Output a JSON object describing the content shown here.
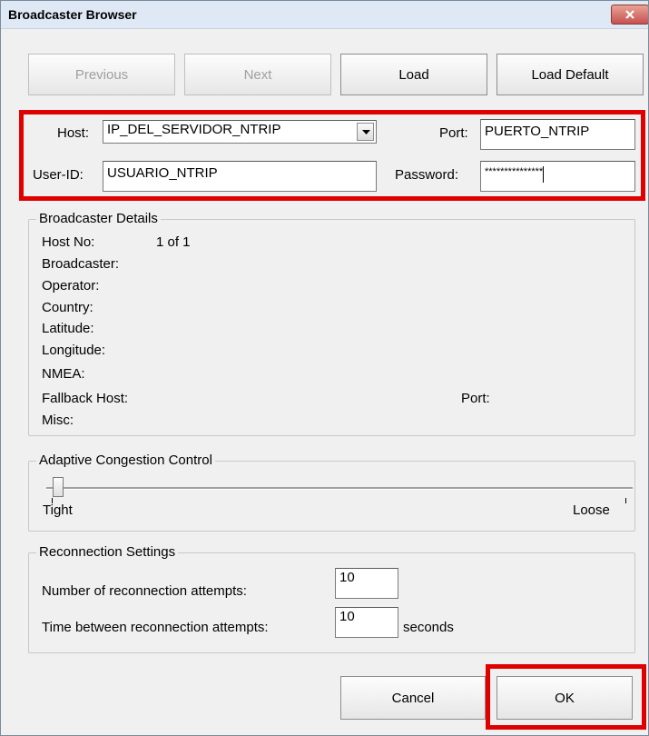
{
  "window": {
    "title": "Broadcaster Browser"
  },
  "buttons": {
    "previous": "Previous",
    "next": "Next",
    "load": "Load",
    "load_default": "Load Default",
    "cancel": "Cancel",
    "ok": "OK"
  },
  "connection": {
    "host_label": "Host:",
    "host_value": "IP_DEL_SERVIDOR_NTRIP",
    "port_label": "Port:",
    "port_value": "PUERTO_NTRIP",
    "userid_label": "User-ID:",
    "userid_value": "USUARIO_NTRIP",
    "password_label": "Password:",
    "password_value": "***************"
  },
  "details": {
    "group_label": "Broadcaster Details",
    "host_no_label": "Host No:",
    "host_no_value": "1 of 1",
    "broadcaster_label": "Broadcaster:",
    "operator_label": "Operator:",
    "country_label": "Country:",
    "latitude_label": "Latitude:",
    "longitude_label": "Longitude:",
    "nmea_label": "NMEA:",
    "fallback_host_label": "Fallback Host:",
    "port_label": "Port:",
    "misc_label": "Misc:"
  },
  "congestion": {
    "group_label": "Adaptive Congestion Control",
    "min_label": "Tight",
    "max_label": "Loose",
    "slider_level": 0
  },
  "reconnection": {
    "group_label": "Reconnection Settings",
    "attempts_label": "Number of reconnection attempts:",
    "attempts_value": "10",
    "time_label": "Time between reconnection attempts:",
    "time_value": "10",
    "time_unit": "seconds"
  },
  "colors": {
    "highlight": "#e00000"
  }
}
